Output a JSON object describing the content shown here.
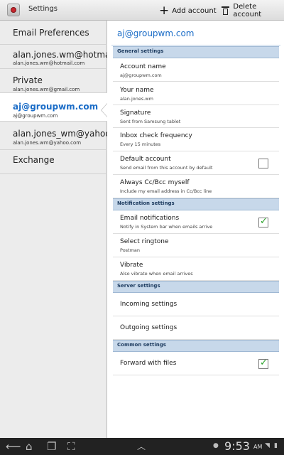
{
  "header": {
    "title": "Settings",
    "add_account": "Add account",
    "delete_account": "Delete account",
    "icons": {
      "app": "email-app-icon",
      "add": "plus-icon",
      "delete": "trash-icon"
    }
  },
  "left_panel": {
    "items": [
      {
        "title": "Email Preferences",
        "subtitle": ""
      },
      {
        "title": "alan.jones.wm@hotmail.com",
        "subtitle": "alan.jones.wm@hotmail.com"
      },
      {
        "title": "Private",
        "subtitle": "alan.jones.wm@gmail.com"
      },
      {
        "title": "aj@groupwm.com",
        "subtitle": "aj@groupwm.com",
        "active": true
      },
      {
        "title": "alan.jones_wm@yahoo.com",
        "subtitle": "alan.jones.wm@yahoo.com"
      },
      {
        "title": "Exchange",
        "subtitle": ""
      }
    ]
  },
  "right_panel": {
    "title": "aj@groupwm.com",
    "sections": {
      "general": "General settings",
      "notification": "Notification settings",
      "server": "Server settings",
      "common": "Common settings"
    },
    "rows": {
      "account_name": {
        "title": "Account name",
        "subtitle": "aj@groupwm.com"
      },
      "your_name": {
        "title": "Your name",
        "subtitle": "alan.jones.wm"
      },
      "signature": {
        "title": "Signature",
        "subtitle": "Sent from Samsung tablet"
      },
      "inbox_frequency": {
        "title": "Inbox check frequency",
        "subtitle": "Every 15 minutes"
      },
      "default_account": {
        "title": "Default account",
        "subtitle": "Send email from this account by default",
        "checked": false
      },
      "always_cc": {
        "title": "Always Cc/Bcc myself",
        "subtitle": "Include my email address in Cc/Bcc line"
      },
      "email_notifications": {
        "title": "Email notifications",
        "subtitle": "Notify in System bar when emails arrive",
        "checked": true
      },
      "ringtone": {
        "title": "Select ringtone",
        "subtitle": "Postman"
      },
      "vibrate": {
        "title": "Vibrate",
        "subtitle": "Also vibrate when email arrives"
      },
      "incoming": {
        "title": "Incoming settings"
      },
      "outgoing": {
        "title": "Outgoing settings"
      },
      "forward_files": {
        "title": "Forward with files",
        "checked": true
      }
    }
  },
  "navbar": {
    "time": "9:53",
    "ampm": "AM",
    "icons": [
      "back-icon",
      "home-icon",
      "recent-apps-icon",
      "screenshot-icon",
      "up-arrow-icon",
      "android-icon",
      "wifi-icon",
      "battery-icon"
    ]
  },
  "colors": {
    "accent": "#1a6cc7",
    "section_bg": "#c7d8ea",
    "check_green": "#2aa22a",
    "navbar_bg": "#222222"
  }
}
